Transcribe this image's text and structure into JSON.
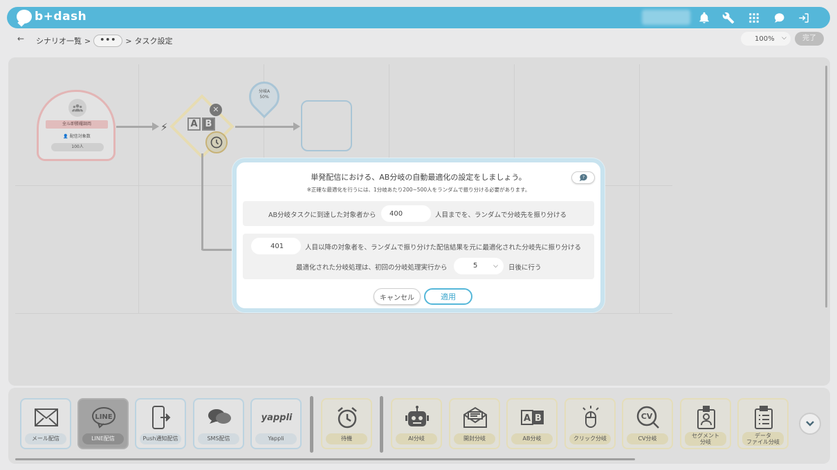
{
  "app": {
    "logo_text": "b+dash"
  },
  "breadcrumb": {
    "back": "←",
    "root": "シナリオ一覧",
    "sep1": ">",
    "ellipsis": "•••",
    "sep2": ">",
    "current": "タスク設定"
  },
  "zoom": {
    "value": "100%"
  },
  "done_button": "完了",
  "canvas": {
    "start_node": {
      "title": "全ル即勝耀調両",
      "label": "配信対象数",
      "count": "100人"
    },
    "branch_pin": {
      "line1": "分岐A",
      "line2": "50%"
    },
    "ab_letters": [
      "A",
      "B"
    ]
  },
  "modal": {
    "title": "単発配信における、AB分岐の自動最適化の設定をしましょう。",
    "subtitle": "※正確な最適化を行うには、1分岐あたり200~500人をランダムで振り分ける必要があります。",
    "row1_prefix": "AB分岐タスクに到達した対象者から",
    "row1_value": "400",
    "row1_suffix": "人目までを、ランダムで分岐先を振り分ける",
    "row2_value": "401",
    "row2_suffix": "人目以降の対象者を、ランダムで振り分けた配信結果を元に最適化された分岐先に振り分ける",
    "row3_prefix": "最適化された分岐処理は、初回の分岐処理実行から",
    "row3_value": "5",
    "row3_suffix": "日後に行う",
    "cancel": "キャンセル",
    "apply": "適用"
  },
  "toolbar": {
    "delivery": [
      {
        "label": "メール配信",
        "icon": "mail-icon"
      },
      {
        "label": "LINE配信",
        "icon": "line-icon",
        "icon_text": "LINE"
      },
      {
        "label": "Push通知配信",
        "icon": "push-icon"
      },
      {
        "label": "SMS配信",
        "icon": "sms-icon"
      },
      {
        "label": "Yappli",
        "icon": "yappli-icon",
        "icon_text": "yappli"
      }
    ],
    "wait": {
      "label": "待機",
      "icon": "alarm-clock-icon"
    },
    "branches": [
      {
        "label": "AI分岐",
        "icon": "robot-icon"
      },
      {
        "label": "開封分岐",
        "icon": "open-mail-icon"
      },
      {
        "label": "AB分岐",
        "icon": "ab-icon"
      },
      {
        "label": "クリック分岐",
        "icon": "mouse-icon"
      },
      {
        "label": "CV分岐",
        "icon": "cv-icon",
        "icon_text": "CV"
      },
      {
        "label_line1": "セグメント",
        "label_line2": "分岐",
        "icon": "badge-icon"
      },
      {
        "label_line1": "データ",
        "label_line2": "ファイル分岐",
        "icon": "clipboard-icon"
      }
    ]
  },
  "colors": {
    "accent": "#55b7d9",
    "overlay": "#dcdcdc",
    "branch_border": "#e4ddba",
    "delivery_border": "#bcd3e0"
  }
}
